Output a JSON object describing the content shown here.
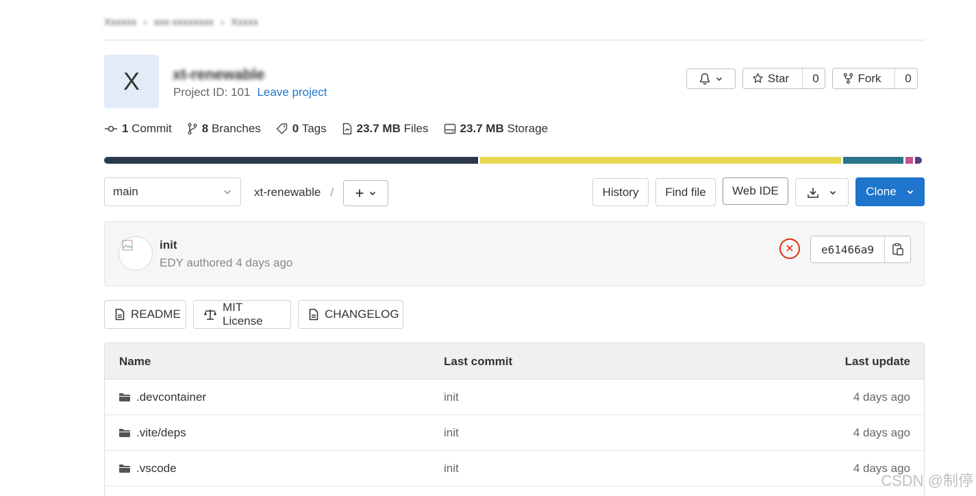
{
  "breadcrumb": [
    "Xxxxxx",
    "xxx-xxxxxxxx",
    "Xxxxx"
  ],
  "project": {
    "avatar_letter": "X",
    "name": "xt-renewable",
    "id_text": "Project ID: 101",
    "leave_label": "Leave project"
  },
  "actions": {
    "star_label": "Star",
    "star_count": "0",
    "fork_label": "Fork",
    "fork_count": "0"
  },
  "stats": {
    "commits_num": "1",
    "commits_label": "Commit",
    "branches_num": "8",
    "branches_label": "Branches",
    "tags_num": "0",
    "tags_label": "Tags",
    "files_num": "23.7 MB",
    "files_label": "Files",
    "storage_num": "23.7 MB",
    "storage_label": "Storage"
  },
  "languages": [
    {
      "color": "#2b3a4a",
      "share": 0.46
    },
    {
      "color": "#e8d84f",
      "share": 0.445
    },
    {
      "color": "#2b7489",
      "share": 0.074
    },
    {
      "color": "#c6538c",
      "share": 0.009
    },
    {
      "color": "#563d7c",
      "share": 0.009
    }
  ],
  "repo_nav": {
    "branch": "main",
    "path": "xt-renewable",
    "path_sep": "/",
    "history_label": "History",
    "find_file_label": "Find file",
    "web_ide_label": "Web IDE",
    "clone_label": "Clone"
  },
  "last_commit": {
    "title": "init",
    "subtitle": "EDY authored 4 days ago",
    "sha": "e61466a9"
  },
  "doc_buttons": {
    "readme": "README",
    "license": "MIT License",
    "changelog": "CHANGELOG"
  },
  "table": {
    "col_name": "Name",
    "col_commit": "Last commit",
    "col_update": "Last update",
    "rows": [
      {
        "name": ".devcontainer",
        "commit": "init",
        "date": "4 days ago"
      },
      {
        "name": ".vite/deps",
        "commit": "init",
        "date": "4 days ago"
      },
      {
        "name": ".vscode",
        "commit": "init",
        "date": "4 days ago"
      }
    ]
  },
  "watermark": "CSDN @制停",
  "colors": {
    "link": "#1f75cb",
    "primary": "#1f75cb",
    "error": "#dd2b0e"
  }
}
